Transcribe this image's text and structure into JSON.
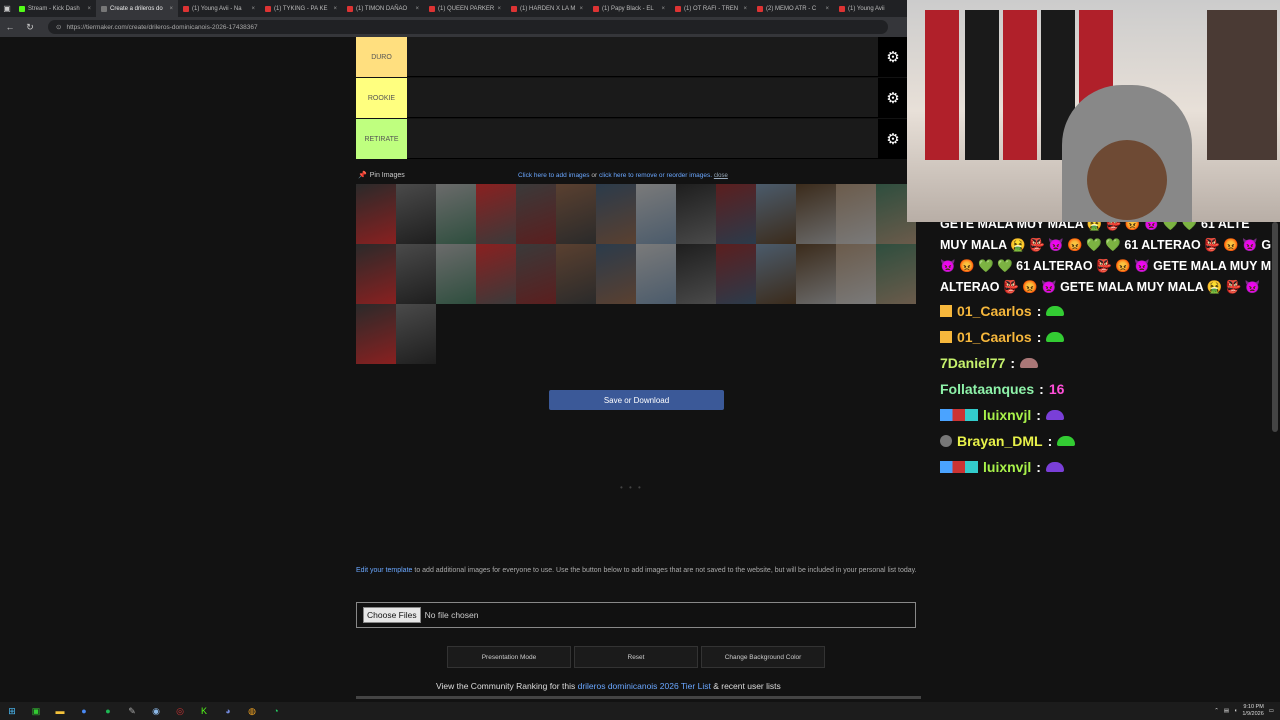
{
  "browser": {
    "tabs": [
      {
        "title": "Stream - Kick Dash",
        "icon": "kick",
        "active": false
      },
      {
        "title": "Create a drileros do",
        "icon": "tiermaker",
        "active": true
      },
      {
        "title": "(1) Young Avii - Na",
        "icon": "youtube",
        "active": false
      },
      {
        "title": "(1) TYKING - PA KE",
        "icon": "youtube",
        "active": false
      },
      {
        "title": "(1) TIMON DAÑAO",
        "icon": "youtube",
        "active": false
      },
      {
        "title": "(1) QUEEN PARKER",
        "icon": "youtube",
        "active": false
      },
      {
        "title": "(1) HARDEN X LA M",
        "icon": "youtube",
        "active": false
      },
      {
        "title": "(1) Papy Black - EL",
        "icon": "youtube",
        "active": false
      },
      {
        "title": "(1) OT RAFI - TREN",
        "icon": "youtube",
        "active": false
      },
      {
        "title": "(2) MEMO ATR - C",
        "icon": "youtube",
        "active": false
      },
      {
        "title": "(1) Young Avii",
        "icon": "youtube",
        "active": false
      }
    ],
    "url": "https://tiermaker.com/create/drileros-dominicanois-2026-17438367"
  },
  "tiers": [
    {
      "label": "DURO",
      "color": "#ffdf7f"
    },
    {
      "label": "ROOKIE",
      "color": "#ffff7f"
    },
    {
      "label": "RETIRATE",
      "color": "#bfff7f"
    }
  ],
  "pin_images_label": "Pin Images",
  "links": {
    "add_images": "Click here to add images",
    "or": "or",
    "remove_images": "click here to remove or reorder images.",
    "close": "close"
  },
  "image_count": 30,
  "save_label": "Save or Download",
  "loading_dots": "• • •",
  "info": {
    "edit_template": "Edit your template",
    "rest": "to add additional images for everyone to use. Use the button below to add images that are not saved to the website, but will be included in your personal list today."
  },
  "file_input": {
    "button": "Choose Files",
    "status": "No file chosen"
  },
  "buttons": {
    "presentation": "Presentation Mode",
    "reset": "Reset",
    "change_bg": "Change Background Color"
  },
  "community": {
    "prefix": "View the Community Ranking for this",
    "link": "drileros dominicanois 2026 Tier List",
    "suffix": "& recent user lists"
  },
  "chat": {
    "spam_lines": [
      "GETE MALA MUY MALA 🤮 👺 😡 👿 💚 💚 61 ALTE",
      "MUY MALA 🤮 👺 👿 😡 💚 💚 61 ALTERAO 👺 😡 👿 G",
      "👿 😡 💚 💚 61 ALTERAO 👺 😡 👿 GETE MALA MUY M",
      "ALTERAO 👺 😡 👿 GETE MALA MUY MALA 🤮 👺 👿"
    ],
    "messages": [
      {
        "user": "01_Caarlos",
        "color": "#f6b73c",
        "badge": "crown",
        "text": "",
        "emote": "#3c3"
      },
      {
        "user": "01_Caarlos",
        "color": "#f6b73c",
        "badge": "crown",
        "text": "",
        "emote": "#3c3"
      },
      {
        "user": "7Daniel77",
        "color": "#c6f26d",
        "badge": "",
        "text": "",
        "emote": "#a77"
      },
      {
        "user": "Follataanques",
        "color": "#8ef2a9",
        "badge": "",
        "text": "16",
        "emote": ""
      },
      {
        "user": "luixnvjl",
        "color": "#a8f24a",
        "badge": "multi",
        "text": "",
        "emote": "#7a3fd8"
      },
      {
        "user": "Brayan_DML",
        "color": "#e8f24a",
        "badge": "dot",
        "text": "",
        "emote": "#3c3"
      },
      {
        "user": "luixnvjl",
        "color": "#a8f24a",
        "badge": "multi",
        "text": "",
        "emote": "#7a3fd8"
      }
    ]
  },
  "taskbar": {
    "time": "9:10 PM",
    "date": "1/9/2026"
  }
}
